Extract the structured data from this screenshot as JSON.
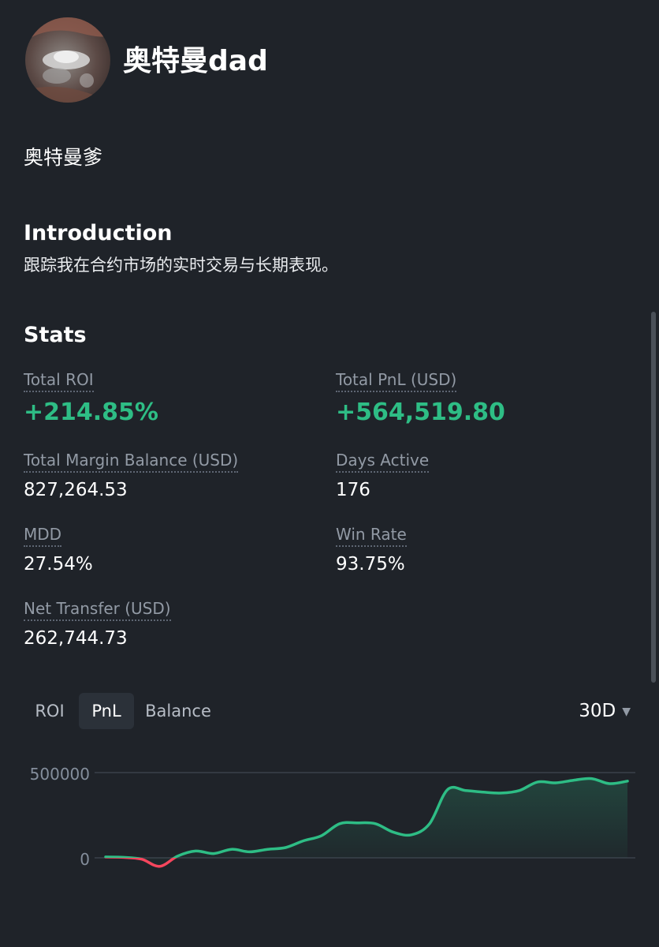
{
  "profile": {
    "name": "奥特曼dad",
    "nickname": "奥特曼爹"
  },
  "introduction": {
    "heading": "Introduction",
    "text": "跟踪我在合约市场的实时交易与长期表现。"
  },
  "stats": {
    "heading": "Stats",
    "items": [
      {
        "label": "Total ROI",
        "value": "+214.85%"
      },
      {
        "label": "Total PnL (USD)",
        "value": "+564,519.80"
      },
      {
        "label": "Total Margin Balance (USD)",
        "value": "827,264.53"
      },
      {
        "label": "Days Active",
        "value": "176"
      },
      {
        "label": "MDD",
        "value": "27.54%"
      },
      {
        "label": "Win Rate",
        "value": "93.75%"
      },
      {
        "label": "Net Transfer (USD)",
        "value": "262,744.73"
      }
    ]
  },
  "chart_controls": {
    "tabs": [
      "ROI",
      "PnL",
      "Balance"
    ],
    "active_tab": "PnL",
    "range": "30D"
  },
  "colors": {
    "positive": "#2ebd85",
    "negative": "#f6465d",
    "background": "#1f2329"
  },
  "chart_data": {
    "type": "area",
    "series_name": "",
    "ylim": [
      -60000,
      560000
    ],
    "y_ticks": [
      0,
      500000
    ],
    "y_tick_labels": [
      "500000",
      "0"
    ],
    "x": [
      0,
      1,
      2,
      3,
      4,
      5,
      6,
      7,
      8,
      9,
      10,
      11,
      12,
      13,
      14,
      15,
      16,
      17,
      18,
      19,
      20,
      21,
      22,
      23,
      24,
      25,
      26,
      27,
      28,
      29
    ],
    "values": [
      5000,
      3000,
      -8000,
      -50000,
      10000,
      40000,
      25000,
      50000,
      35000,
      50000,
      60000,
      100000,
      130000,
      200000,
      205000,
      200000,
      150000,
      135000,
      200000,
      400000,
      395000,
      385000,
      380000,
      395000,
      445000,
      440000,
      455000,
      465000,
      435000,
      450000
    ]
  }
}
